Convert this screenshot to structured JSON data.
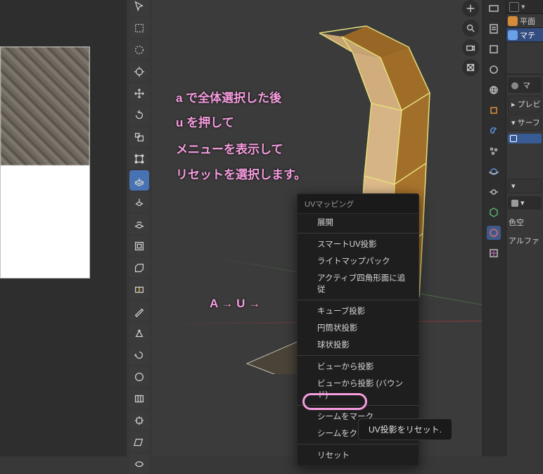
{
  "annot": {
    "line1": "a で全体選択した後",
    "line2": "u を押して",
    "line3": "メニューを表示して",
    "line4": "リセットを選択します。",
    "arrow": "A → U →"
  },
  "uv_menu": {
    "header": "UVマッピング",
    "groups": [
      [
        "展開"
      ],
      [
        "スマートUV投影",
        "ライトマップパック",
        "アクティブ四角形面に追従"
      ],
      [
        "キューブ投影",
        "円筒状投影",
        "球状投影"
      ],
      [
        "ビューから投影",
        "ビューから投影 (バウンド)"
      ],
      [
        "シームをマーク",
        "シームをクリア"
      ],
      [
        "リセット"
      ]
    ]
  },
  "tooltip": "UV投影をリセット.",
  "tools": [
    "cursor",
    "arrow-select",
    "circle-select",
    "lasso",
    "cursor3d",
    "move",
    "rotate",
    "scale",
    "transform",
    "annotate",
    "measure",
    "ecube",
    "ecube2",
    "inset",
    "bevel",
    "loopcut",
    "knife",
    "polybuild",
    "spin",
    "spin-dup",
    "smooth",
    "randomize",
    "edge-slide",
    "shrink-fatten",
    "push-pull",
    "shear",
    "rip",
    "rip-edge"
  ],
  "right_tabs": [
    "render",
    "output",
    "view",
    "scene",
    "world",
    "object",
    "modifier",
    "particles",
    "physics",
    "constraints",
    "data",
    "material",
    "texture"
  ],
  "outliner": {
    "row1": "平面",
    "row2": "マテ"
  },
  "rp": {
    "mat_dropdown": "マ",
    "sec1": "プレビ",
    "sec2": "サーフ",
    "color_label": "色空",
    "alpha_label": "アルファ"
  },
  "vp_icons": [
    "hand",
    "zoom",
    "camera",
    "persp",
    "grid"
  ],
  "icons": {
    "search": "search",
    "gear": "gear"
  }
}
